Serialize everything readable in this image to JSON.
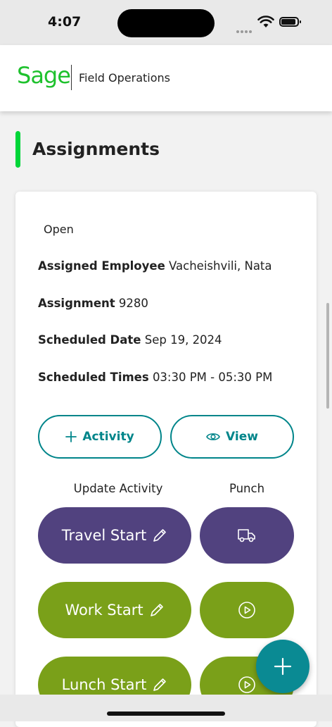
{
  "status_bar": {
    "time": "4:07"
  },
  "header": {
    "brand": "Sage",
    "product": "Field Operations"
  },
  "page": {
    "title": "Assignments"
  },
  "assignment": {
    "status": "Open",
    "fields": [
      {
        "label": "Assigned Employee",
        "value": "Vacheishvili, Nata"
      },
      {
        "label": "Assignment",
        "value": "9280"
      },
      {
        "label": "Scheduled Date",
        "value": "Sep 19, 2024"
      },
      {
        "label": "Scheduled Times",
        "value": "03:30 PM - 05:30 PM"
      }
    ],
    "buttons": {
      "activity": "Activity",
      "view": "View"
    },
    "columns": {
      "update_activity": "Update Activity",
      "punch": "Punch"
    },
    "activities": [
      {
        "label": "Travel Start",
        "punch_icon": "truck-icon",
        "color": "#51427f"
      },
      {
        "label": "Work Start",
        "punch_icon": "play-circle-icon",
        "color": "#7aa019"
      },
      {
        "label": "Lunch Start",
        "punch_icon": "play-circle-icon",
        "color": "#7aa019"
      }
    ]
  },
  "colors": {
    "accent_teal": "#00858a",
    "brand_green": "#1ec12d",
    "title_accent": "#00d639",
    "fab": "#0a8a93"
  }
}
